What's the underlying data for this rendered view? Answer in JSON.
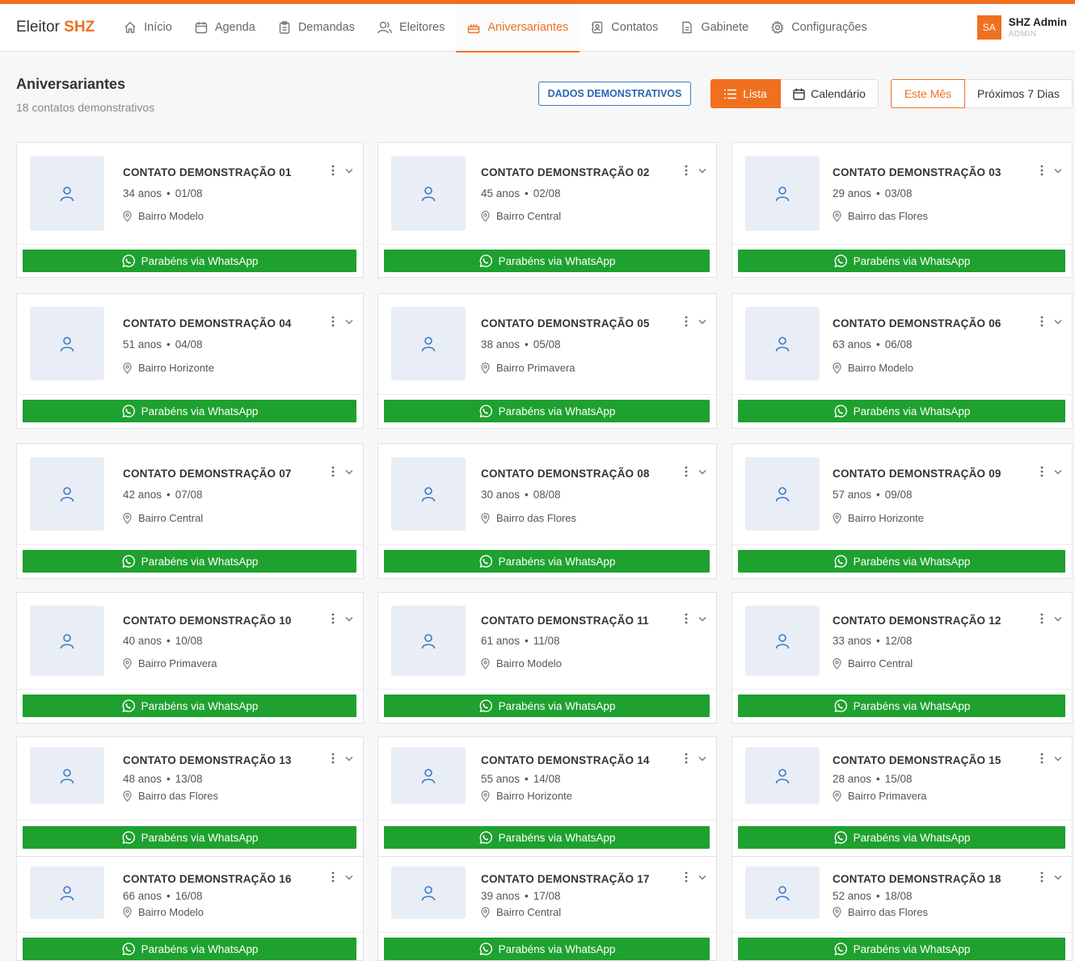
{
  "brand": {
    "prefix": "Eleitor",
    "accent": "SHZ"
  },
  "nav": [
    {
      "label": "Início",
      "icon": "home-icon",
      "active": false
    },
    {
      "label": "Agenda",
      "icon": "calendar-icon",
      "active": false
    },
    {
      "label": "Demandas",
      "icon": "clipboard-icon",
      "active": false
    },
    {
      "label": "Eleitores",
      "icon": "user-icon",
      "active": false
    },
    {
      "label": "Aniversariantes",
      "icon": "cake-icon",
      "active": true
    },
    {
      "label": "Contatos",
      "icon": "contacts-icon",
      "active": false
    },
    {
      "label": "Gabinete",
      "icon": "document-icon",
      "active": false
    },
    {
      "label": "Configurações",
      "icon": "gear-icon",
      "active": false
    }
  ],
  "user": {
    "initials": "SA",
    "name": "SHZ Admin",
    "role": "ADMIN"
  },
  "page": {
    "title": "Aniversariantes",
    "subtitle": "18 contatos demonstrativos",
    "demo_badge": "DADOS DEMONSTRATIVOS"
  },
  "view": {
    "lista": "Lista",
    "calendario": "Calendário"
  },
  "period": {
    "mes": "Este Mês",
    "proximos": "Próximos 7 Dias"
  },
  "colors": {
    "accent": "#f07020",
    "whatsapp": "#1ea12f",
    "demo_badge": "#2a66b0"
  },
  "whatsapp_label": "Parabéns via WhatsApp",
  "contacts": [
    {
      "name": "CONTATO DEMONSTRAÇÃO 01",
      "age": "34 anos",
      "date": "01/08",
      "bairro": "Bairro Modelo"
    },
    {
      "name": "CONTATO DEMONSTRAÇÃO 02",
      "age": "45 anos",
      "date": "02/08",
      "bairro": "Bairro Central"
    },
    {
      "name": "CONTATO DEMONSTRAÇÃO 03",
      "age": "29 anos",
      "date": "03/08",
      "bairro": "Bairro das Flores"
    },
    {
      "name": "CONTATO DEMONSTRAÇÃO 04",
      "age": "51 anos",
      "date": "04/08",
      "bairro": "Bairro Horizonte"
    },
    {
      "name": "CONTATO DEMONSTRAÇÃO 05",
      "age": "38 anos",
      "date": "05/08",
      "bairro": "Bairro Primavera"
    },
    {
      "name": "CONTATO DEMONSTRAÇÃO 06",
      "age": "63 anos",
      "date": "06/08",
      "bairro": "Bairro Modelo"
    },
    {
      "name": "CONTATO DEMONSTRAÇÃO 07",
      "age": "42 anos",
      "date": "07/08",
      "bairro": "Bairro Central"
    },
    {
      "name": "CONTATO DEMONSTRAÇÃO 08",
      "age": "30 anos",
      "date": "08/08",
      "bairro": "Bairro das Flores"
    },
    {
      "name": "CONTATO DEMONSTRAÇÃO 09",
      "age": "57 anos",
      "date": "09/08",
      "bairro": "Bairro Horizonte"
    },
    {
      "name": "CONTATO DEMONSTRAÇÃO 10",
      "age": "40 anos",
      "date": "10/08",
      "bairro": "Bairro Primavera"
    },
    {
      "name": "CONTATO DEMONSTRAÇÃO 11",
      "age": "61 anos",
      "date": "11/08",
      "bairro": "Bairro Modelo"
    },
    {
      "name": "CONTATO DEMONSTRAÇÃO 12",
      "age": "33 anos",
      "date": "12/08",
      "bairro": "Bairro Central"
    },
    {
      "name": "CONTATO DEMONSTRAÇÃO 13",
      "age": "48 anos",
      "date": "13/08",
      "bairro": "Bairro das Flores"
    },
    {
      "name": "CONTATO DEMONSTRAÇÃO 14",
      "age": "55 anos",
      "date": "14/08",
      "bairro": "Bairro Horizonte"
    },
    {
      "name": "CONTATO DEMONSTRAÇÃO 15",
      "age": "28 anos",
      "date": "15/08",
      "bairro": "Bairro Primavera"
    },
    {
      "name": "CONTATO DEMONSTRAÇÃO 16",
      "age": "66 anos",
      "date": "16/08",
      "bairro": "Bairro Modelo"
    },
    {
      "name": "CONTATO DEMONSTRAÇÃO 17",
      "age": "39 anos",
      "date": "17/08",
      "bairro": "Bairro Central"
    },
    {
      "name": "CONTATO DEMONSTRAÇÃO 18",
      "age": "52 anos",
      "date": "18/08",
      "bairro": "Bairro das Flores"
    }
  ]
}
